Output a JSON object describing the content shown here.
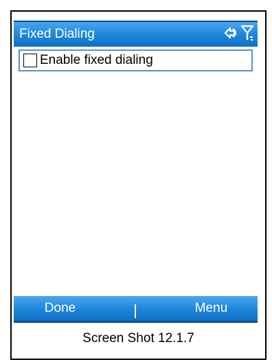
{
  "window": {
    "title": "Fixed Dialing",
    "status_icons": [
      "data-connection-icon",
      "signal-strength-icon"
    ]
  },
  "content": {
    "option": {
      "label": "Enable fixed dialing",
      "checked": false
    }
  },
  "softkeys": {
    "left_label": "Done",
    "right_label": "Menu"
  },
  "caption": "Screen Shot 12.1.7",
  "colors": {
    "bar_top": "#4aa6f0",
    "bar_bottom": "#0f6fc4",
    "focus_border": "#5a8fd0"
  }
}
